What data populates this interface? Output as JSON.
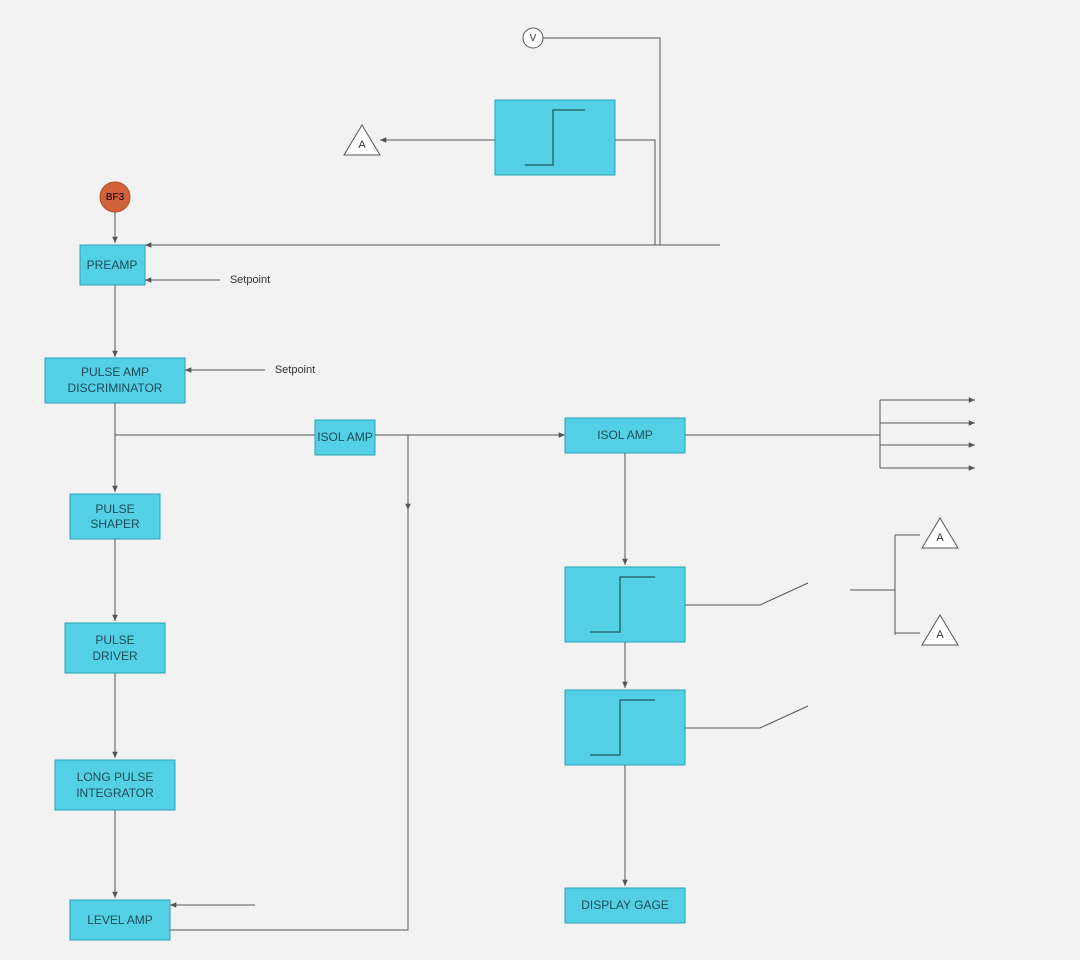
{
  "nodes": {
    "bf3": "BF3",
    "preamp": "PREAMP",
    "pulse_amp_disc_l1": "PULSE AMP",
    "pulse_amp_disc_l2": "DISCRIMINATOR",
    "isol_amp_1": "ISOL AMP",
    "pulse_shaper_l1": "PULSE",
    "pulse_shaper_l2": "SHAPER",
    "pulse_driver_l1": "PULSE",
    "pulse_driver_l2": "DRIVER",
    "long_pulse_int_l1": "LONG PULSE",
    "long_pulse_int_l2": "INTEGRATOR",
    "level_amp": "LEVEL AMP",
    "isol_amp_2": "ISOL AMP",
    "display_gage": "DISPLAY GAGE",
    "setpoint1": "Setpoint",
    "setpoint2": "Setpoint",
    "A": "A",
    "V": "V"
  }
}
